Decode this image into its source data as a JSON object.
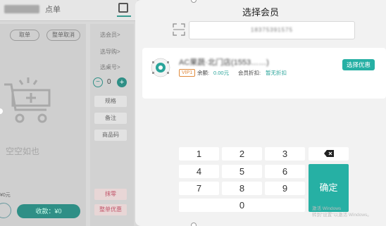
{
  "background_app": {
    "order_title": "点单",
    "hold_button": "取单",
    "cancel_order_button": "整单取消",
    "empty_cart_text": "空空如也",
    "total_text": "¥0元",
    "collect_button": "收款：¥0",
    "right_links": [
      "选会员>",
      "选导购>",
      "选桌号>"
    ],
    "quantity": "0",
    "chips": [
      "规格",
      "备注",
      "商品码"
    ],
    "bottom_chips": [
      "抹零",
      "整单优惠"
    ]
  },
  "modal": {
    "title": "选择会员",
    "phone_input_value": "18375391575",
    "member": {
      "name": "AC果蔬·北门店(1553……)",
      "level": "VIP1",
      "balance_label": "余额:",
      "balance_value": "0.00元",
      "discount_label": "会员折扣:",
      "discount_value": "暂无折扣",
      "promo_button": "选择优惠"
    },
    "keypad": {
      "keys": [
        "1",
        "2",
        "3",
        "4",
        "5",
        "6",
        "7",
        "8",
        "9",
        "0"
      ],
      "backspace_icon": "backspace-icon",
      "confirm_label": "确定"
    },
    "watermark": [
      "激活 Windows",
      "转到\"设置\"以激活 Windows。"
    ]
  },
  "colors": {
    "accent": "#26b0a4",
    "vip_orange": "#e08a3c"
  }
}
